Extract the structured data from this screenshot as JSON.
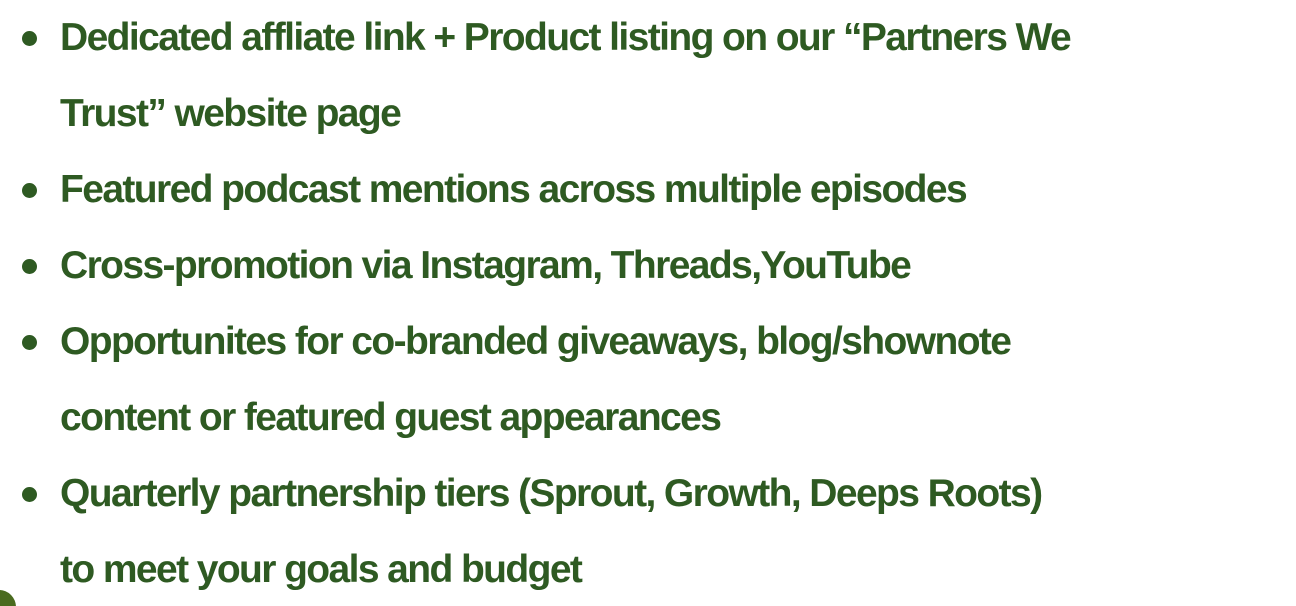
{
  "colors": {
    "text": "#2e5a22",
    "background": "#ffffff",
    "accent": "#4a6b1f"
  },
  "bullets": [
    {
      "text": "Dedicated affliate link + Product listing on our “Partners We\nTrust” website page"
    },
    {
      "text": "Featured podcast mentions across multiple episodes"
    },
    {
      "text": "Cross-promotion via Instagram, Threads,YouTube"
    },
    {
      "text": "Opportunites for co-branded giveaways, blog/shownote\ncontent or featured guest appearances"
    },
    {
      "text": "Quarterly partnership tiers (Sprout, Growth, Deeps Roots)\nto meet your goals and budget"
    }
  ]
}
